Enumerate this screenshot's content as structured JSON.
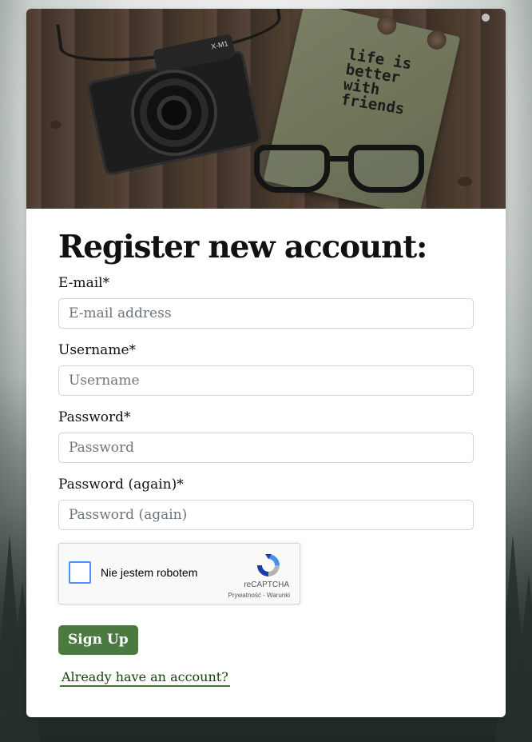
{
  "form": {
    "title": "Register new account:",
    "email": {
      "label": "E-mail*",
      "placeholder": "E-mail address"
    },
    "username": {
      "label": "Username*",
      "placeholder": "Username"
    },
    "password": {
      "label": "Password*",
      "placeholder": "Password"
    },
    "password_again": {
      "label": "Password (again)*",
      "placeholder": "Password (again)"
    },
    "captcha": {
      "checkbox_label": "Nie jestem robotem",
      "brand": "reCAPTCHA",
      "links": "Prywatność - Warunki"
    },
    "submit_label": "Sign Up",
    "login_link": "Already have an account?"
  },
  "hero": {
    "notebook_text": "life is better with friends",
    "camera_label": "X-M1"
  },
  "colors": {
    "accent": "#4a7a40",
    "link_underline": "#3c7a30",
    "checkbox_border": "#4d90fe"
  }
}
